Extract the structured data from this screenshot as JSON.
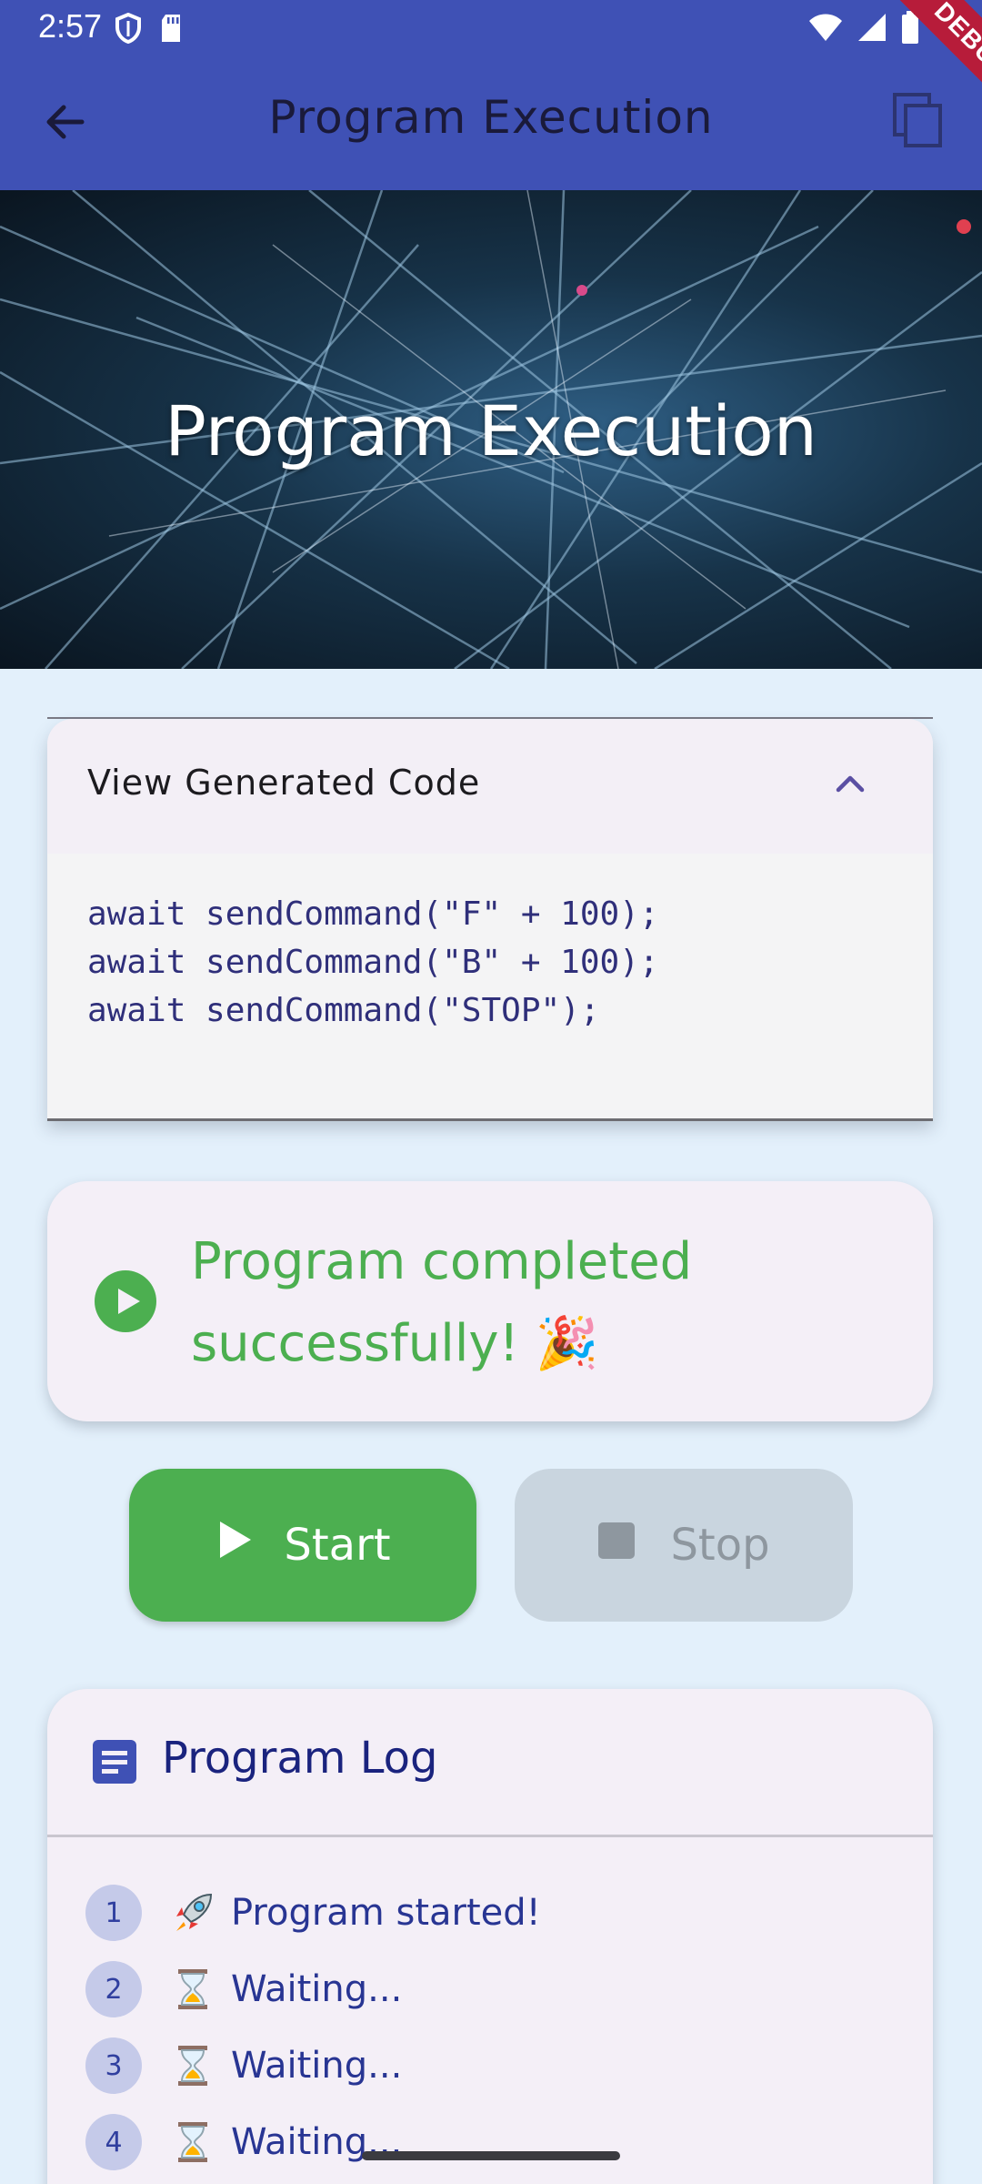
{
  "status_bar": {
    "time": "2:57"
  },
  "app_bar": {
    "title": "Program Execution",
    "debug_label": "DEBUG"
  },
  "hero": {
    "title": "Program Execution"
  },
  "code_panel": {
    "header": "View Generated Code",
    "lines": [
      "await sendCommand(\"F\" + 100);",
      "await sendCommand(\"B\" + 100);",
      "await sendCommand(\"STOP\");"
    ]
  },
  "status": {
    "line1": "Program completed",
    "line2": "successfully! 🎉",
    "color": "#4caf50"
  },
  "controls": {
    "start_label": "Start",
    "stop_label": "Stop"
  },
  "log": {
    "title": "Program Log",
    "items": [
      {
        "num": "1",
        "text": "Program started!",
        "icon": "rocket-icon"
      },
      {
        "num": "2",
        "text": "Waiting...",
        "icon": "hourglass-icon"
      },
      {
        "num": "3",
        "text": "Waiting...",
        "icon": "hourglass-icon"
      },
      {
        "num": "4",
        "text": "Waiting...",
        "icon": "hourglass-icon"
      }
    ]
  },
  "colors": {
    "app_bar": "#3f51b5",
    "accent_green": "#4caf50",
    "background": "#e3f0fb"
  }
}
